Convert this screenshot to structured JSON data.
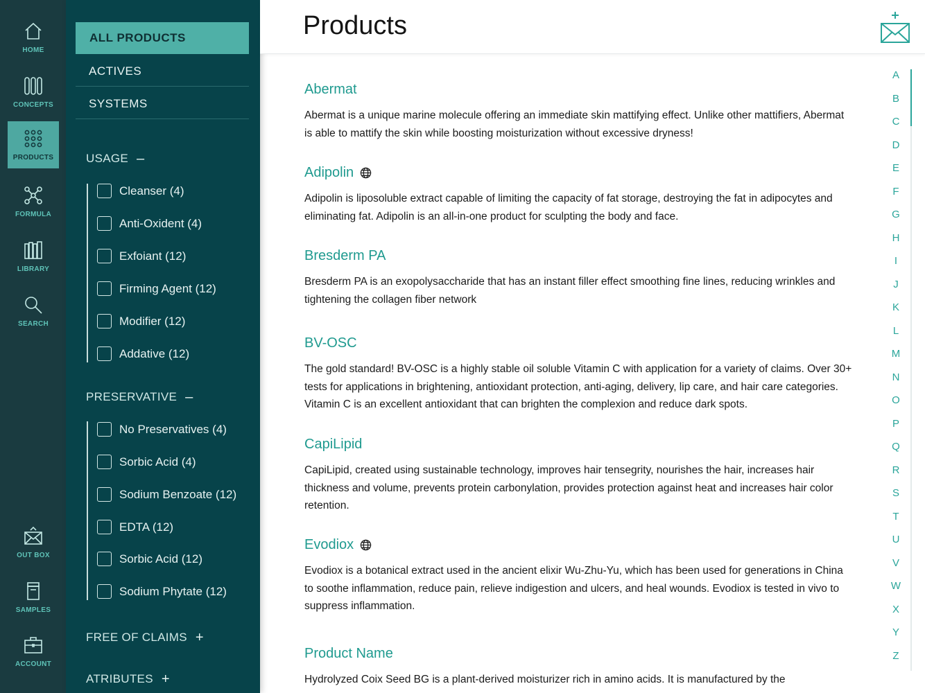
{
  "rail": {
    "items": [
      {
        "key": "home",
        "label": "HOME",
        "icon": "home-icon"
      },
      {
        "key": "concepts",
        "label": "CONCEPTS",
        "icon": "concepts-icon"
      },
      {
        "key": "products",
        "label": "PRODUCTS",
        "icon": "grid-dots-icon",
        "active": true
      },
      {
        "key": "formula",
        "label": "FORMULA",
        "icon": "molecule-icon"
      },
      {
        "key": "library",
        "label": "LIBRARY",
        "icon": "books-icon"
      },
      {
        "key": "search",
        "label": "SEARCH",
        "icon": "search-icon"
      },
      {
        "key": "outbox",
        "label": "OUT BOX",
        "icon": "envelope-icon"
      },
      {
        "key": "samples",
        "label": "SAMPLES",
        "icon": "jar-icon"
      },
      {
        "key": "account",
        "label": "ACCOUNT",
        "icon": "briefcase-icon"
      }
    ]
  },
  "filters": {
    "categories": [
      "ALL PRODUCTS",
      "ACTIVES",
      "SYSTEMS"
    ],
    "usage": {
      "title": "USAGE",
      "toggle": "–",
      "options": [
        "Cleanser (4)",
        "Anti-Oxident (4)",
        "Exfoiant (12)",
        "Firming Agent (12)",
        "Modifier (12)",
        "Addative (12)"
      ]
    },
    "preservative": {
      "title": "PRESERVATIVE",
      "toggle": "–",
      "options": [
        "No Preservatives (4)",
        "Sorbic Acid (4)",
        "Sodium Benzoate (12)",
        "EDTA (12)",
        "Sorbic Acid (12)",
        "Sodium Phytate (12)"
      ]
    },
    "free_of_claims": {
      "title": "FREE OF CLAIMS",
      "toggle": "+"
    },
    "atributes": {
      "title": "ATRIBUTES",
      "toggle": "+"
    }
  },
  "header": {
    "title": "Products"
  },
  "products": [
    {
      "name": "Abermat",
      "globe": false,
      "description": "Abermat is a unique marine molecule offering an immediate skin mattifying effect. Unlike other mattifiers, Abermat is able to mattify the skin while boosting moisturization without excessive dryness!"
    },
    {
      "name": "Adipolin",
      "globe": true,
      "description": "Adipolin is liposoluble extract capable of limiting the capacity of fat storage, destroying the fat in adipocytes and eliminating fat. Adipolin is an all-in-one product for sculpting the body and face."
    },
    {
      "name": "Bresderm PA",
      "globe": false,
      "description": "Bresderm PA is an exopolysaccharide that has an instant filler effect smoothing fine lines, reducing wrinkles and tightening the collagen fiber network"
    },
    {
      "name": "BV-OSC",
      "globe": false,
      "description": "The gold standard! BV-OSC is a highly stable oil soluble Vitamin C with application for a variety of claims. Over 30+ tests for applications in brightening, antioxidant protection, anti-aging, delivery, lip care, and hair care categories. Vitamin C is an excellent antioxidant that can brighten the complexion and reduce dark spots."
    },
    {
      "name": "CapiLipid",
      "globe": false,
      "description": "CapiLipid, created using sustainable technology, improves hair tensegrity, nourishes the hair, increases hair thickness and volume, prevents protein carbonylation, provides protection against heat and increases hair color retention."
    },
    {
      "name": "Evodiox",
      "globe": true,
      "description": "Evodiox is a botanical extract used in the ancient elixir Wu-Zhu-Yu, which has been used for generations in China to soothe inflammation, reduce pain, relieve indigestion and ulcers, and heal wounds. Evodiox is tested in vivo to suppress inflammation."
    },
    {
      "name": "Product Name",
      "globe": false,
      "description": "Hydrolyzed Coix Seed BG is a plant-derived moisturizer rich in amino acids. It is manufactured by the"
    }
  ],
  "alphabet": [
    "A",
    "B",
    "C",
    "D",
    "E",
    "F",
    "G",
    "H",
    "I",
    "J",
    "K",
    "L",
    "M",
    "N",
    "O",
    "P",
    "Q",
    "R",
    "S",
    "T",
    "U",
    "V",
    "W",
    "X",
    "Y",
    "Z"
  ],
  "colors": {
    "rail_bg": "#1a3b40",
    "panel_bg": "#07434a",
    "accent": "#4fb0a7",
    "link": "#1f9a8f"
  }
}
